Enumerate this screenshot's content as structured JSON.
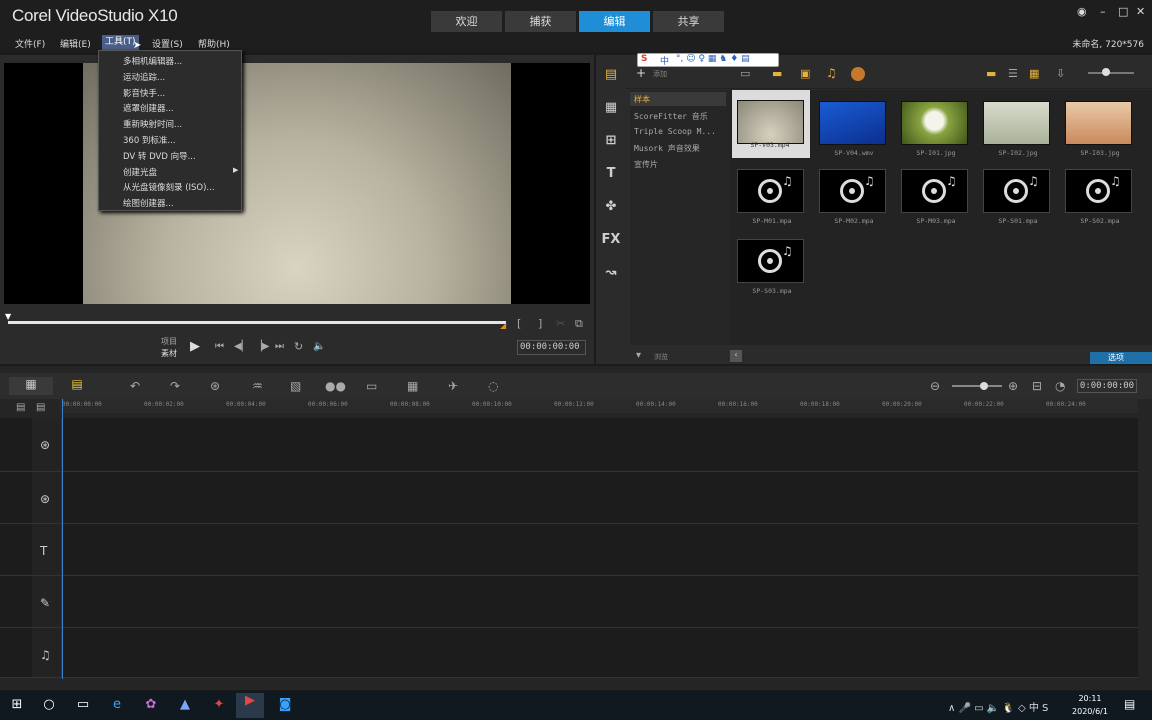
{
  "app": {
    "logo": "Corel VideoStudio X10",
    "project": "未命名, 720*576"
  },
  "tabs": [
    "欢迎",
    "捕获",
    "编辑",
    "共享"
  ],
  "menus": [
    "文件(F)",
    "编辑(E)",
    "工具(T)",
    "设置(S)",
    "帮助(H)"
  ],
  "tools_menu": [
    "多相机编辑器...",
    "运动追踪...",
    "影音快手...",
    "遮罩创建器...",
    "重新映射时间...",
    "360 到标准...",
    "DV 转 DVD 向导...",
    "创建光盘",
    "从光盘镜像刻录 (ISO)...",
    "绘图创建器..."
  ],
  "player": {
    "project_label": "项目",
    "clip_label": "素材",
    "timecode": "00:00:00:00"
  },
  "library": {
    "add_label": "添加",
    "browse_label": "浏览",
    "options_label": "选项",
    "folders": [
      "样本",
      "ScoreFitter 音乐",
      "Triple Scoop M...",
      "Musork 声音效果",
      "宣传片"
    ],
    "items": [
      {
        "name": "SP-V03.mp4",
        "kind": "video"
      },
      {
        "name": "SP-V04.wmv",
        "kind": "video"
      },
      {
        "name": "SP-I01.jpg",
        "kind": "image"
      },
      {
        "name": "SP-I02.jpg",
        "kind": "image"
      },
      {
        "name": "SP-I03.jpg",
        "kind": "image"
      },
      {
        "name": "SP-M01.mpa",
        "kind": "audio"
      },
      {
        "name": "SP-M02.mpa",
        "kind": "audio"
      },
      {
        "name": "SP-M03.mpa",
        "kind": "audio"
      },
      {
        "name": "SP-S01.mpa",
        "kind": "audio"
      },
      {
        "name": "SP-S02.mpa",
        "kind": "audio"
      },
      {
        "name": "SP-S03.mpa",
        "kind": "audio"
      }
    ]
  },
  "timeline": {
    "timecode": "0:00:00:00",
    "ruler": [
      "00:00:00:00",
      "00:00:02:00",
      "00:00:04:00",
      "00:00:06:00",
      "00:00:08:00",
      "00:00:10:00",
      "00:00:12:00",
      "00:00:14:00",
      "00:00:16:00",
      "00:00:18:00",
      "00:00:20:00",
      "00:00:22:00",
      "00:00:24:00"
    ]
  },
  "ime": {
    "label": "中"
  },
  "taskbar": {
    "time": "20:11",
    "date": "2020/6/1",
    "lang": "中"
  }
}
